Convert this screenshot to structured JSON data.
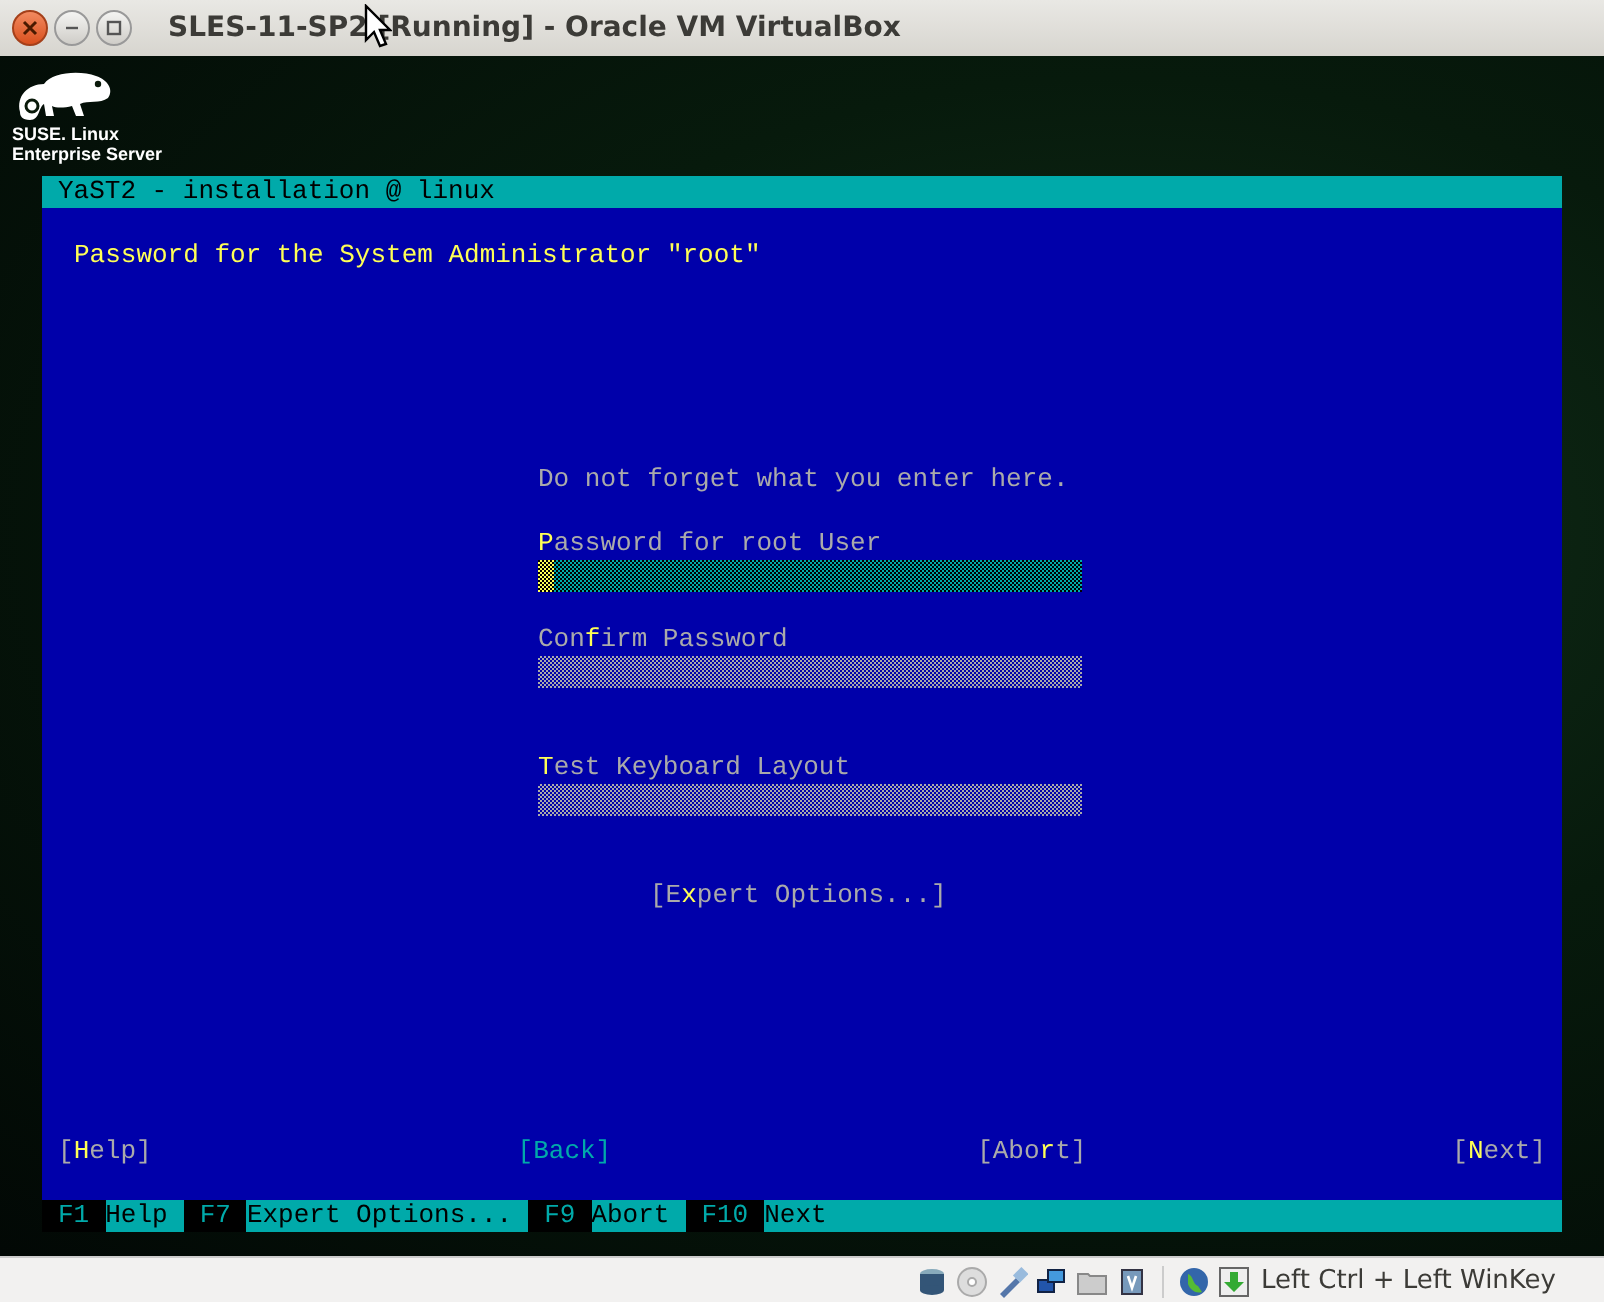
{
  "window": {
    "title": "SLES-11-SP2 [Running] - Oracle VM VirtualBox"
  },
  "logo": {
    "line1": "SUSE. Linux",
    "line2": "Enterprise Server"
  },
  "terminal": {
    "title": "YaST2 - installation @ linux",
    "heading": "Password for the System Administrator \"root\"",
    "note": "Do not forget what you enter here.",
    "fields": [
      {
        "label": "**P**assword for root User",
        "focused": true
      },
      {
        "label": "Con**f**irm Password",
        "focused": false
      }
    ],
    "test_field": {
      "label": "**T**est Keyboard Layout",
      "focused": false
    },
    "expert_button": {
      "label": "[E**x**pert Options...]"
    },
    "buttons": [
      {
        "label": "[**H**elp]",
        "disabled": false
      },
      {
        "label": "[Back]",
        "disabled": true
      },
      {
        "label": "[Abo**r**t]",
        "disabled": false
      },
      {
        "label": "[**N**ext]",
        "disabled": false
      }
    ],
    "fkeys": [
      {
        "key": "F1",
        "label": "Help"
      },
      {
        "key": "F7",
        "label": "Expert Options..."
      },
      {
        "key": "F9",
        "label": "Abort"
      },
      {
        "key": "F10",
        "label": "Next"
      }
    ]
  },
  "status_bar": {
    "hostkey": "Left Ctrl + Left WinKey"
  }
}
